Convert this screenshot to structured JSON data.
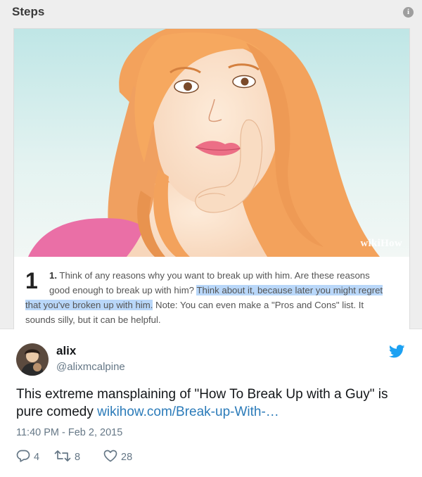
{
  "wikihow": {
    "header_title": "Steps",
    "info_icon": "i",
    "watermark": "wikiHow",
    "step_number": "1",
    "step_lines": [
      {
        "a": "1.",
        "b": " Think of any reasons why you want to break up with him. Are these reasons"
      },
      {
        "a": "good enough to break up with him? ",
        "hl": "Think about it, because later you might regret"
      },
      {
        "hl": "that you've broken up with him.",
        "rest": " Note: You can even make a \"Pros and Cons\" list. It"
      },
      {
        "rest": "sounds silly, but it can be helpful."
      }
    ]
  },
  "tweet": {
    "name": "alix",
    "handle": "@alixmcalpine",
    "body_text": "This extreme mansplaining of \"How To Break Up with a Guy\" is pure comedy ",
    "link_text": "wikihow.com/Break-up-With-…",
    "timestamp": "11:40 PM - Feb 2, 2015",
    "actions": {
      "replies": "4",
      "retweets": "8",
      "likes": "28"
    },
    "colors": {
      "text": "#14171a",
      "muted": "#657786",
      "link": "#2b7bb9",
      "bird": "#1da1f2",
      "highlight": "#b9d7f9"
    }
  }
}
